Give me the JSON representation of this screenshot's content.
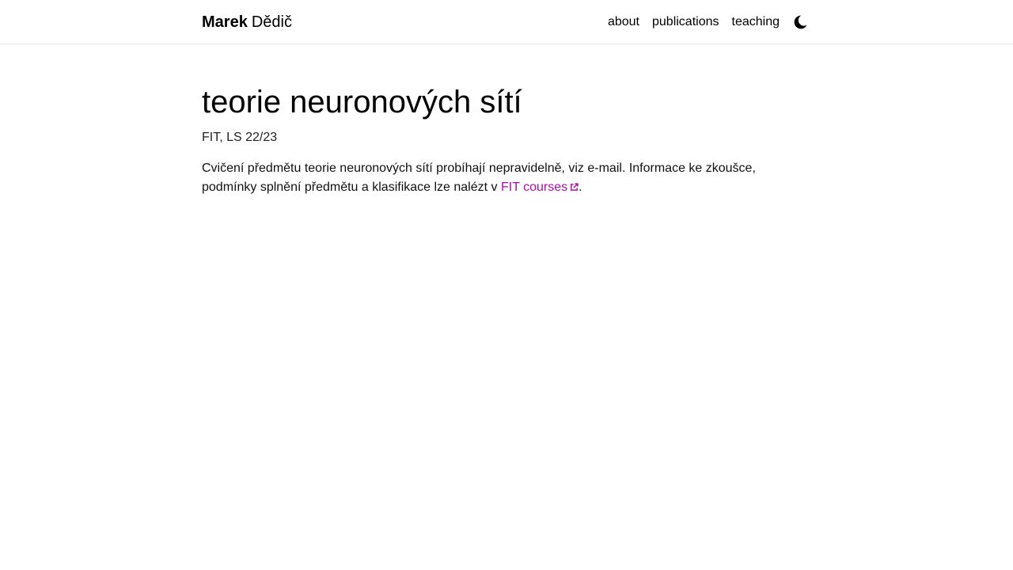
{
  "header": {
    "brand_first": "Marek",
    "brand_last": "Dědič",
    "nav": [
      {
        "label": "about"
      },
      {
        "label": "publications"
      },
      {
        "label": "teaching"
      }
    ],
    "theme_toggle_icon": "moon-icon"
  },
  "main": {
    "title": "teorie neuronových sítí",
    "subtitle": "FIT, LS 22/23",
    "body_text": "Cvičení předmětu teorie neuronových sítí probíhají nepravidelně, viz e-mail. Informace ke zkoušce, podmínky splnění předmětu a klasifikace lze nalézt v ",
    "link_label": "FIT courses",
    "link_icon": "external-link-icon",
    "body_end": "."
  },
  "colors": {
    "accent": "#b509ac",
    "border": "#e5e5e5",
    "text": "#000000"
  }
}
